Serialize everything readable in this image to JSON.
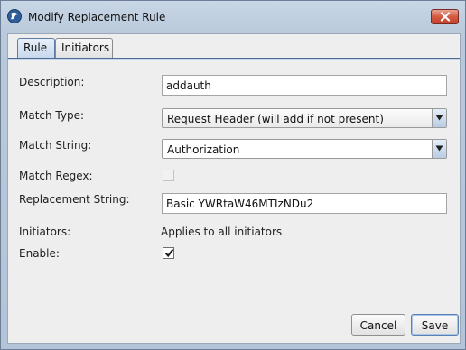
{
  "window": {
    "title": "Modify Replacement Rule"
  },
  "tabs": [
    {
      "label": "Rule"
    },
    {
      "label": "Initiators"
    }
  ],
  "form": {
    "description_label": "Description:",
    "description_value": "addauth",
    "match_type_label": "Match Type:",
    "match_type_value": "Request Header (will add if not present)",
    "match_string_label": "Match String:",
    "match_string_value": "Authorization",
    "match_regex_label": "Match Regex:",
    "match_regex_checked": false,
    "replacement_string_label": "Replacement String:",
    "replacement_string_value": "Basic YWRtaW46MTIzNDu2",
    "initiators_label": "Initiators:",
    "initiators_value": "Applies to all initiators",
    "enable_label": "Enable:",
    "enable_checked": true
  },
  "buttons": {
    "cancel": "Cancel",
    "save": "Save"
  },
  "icons": {
    "app": "app-logo-icon",
    "close": "close-icon",
    "dropdown": "chevron-down-icon",
    "check": "checkmark-icon"
  }
}
